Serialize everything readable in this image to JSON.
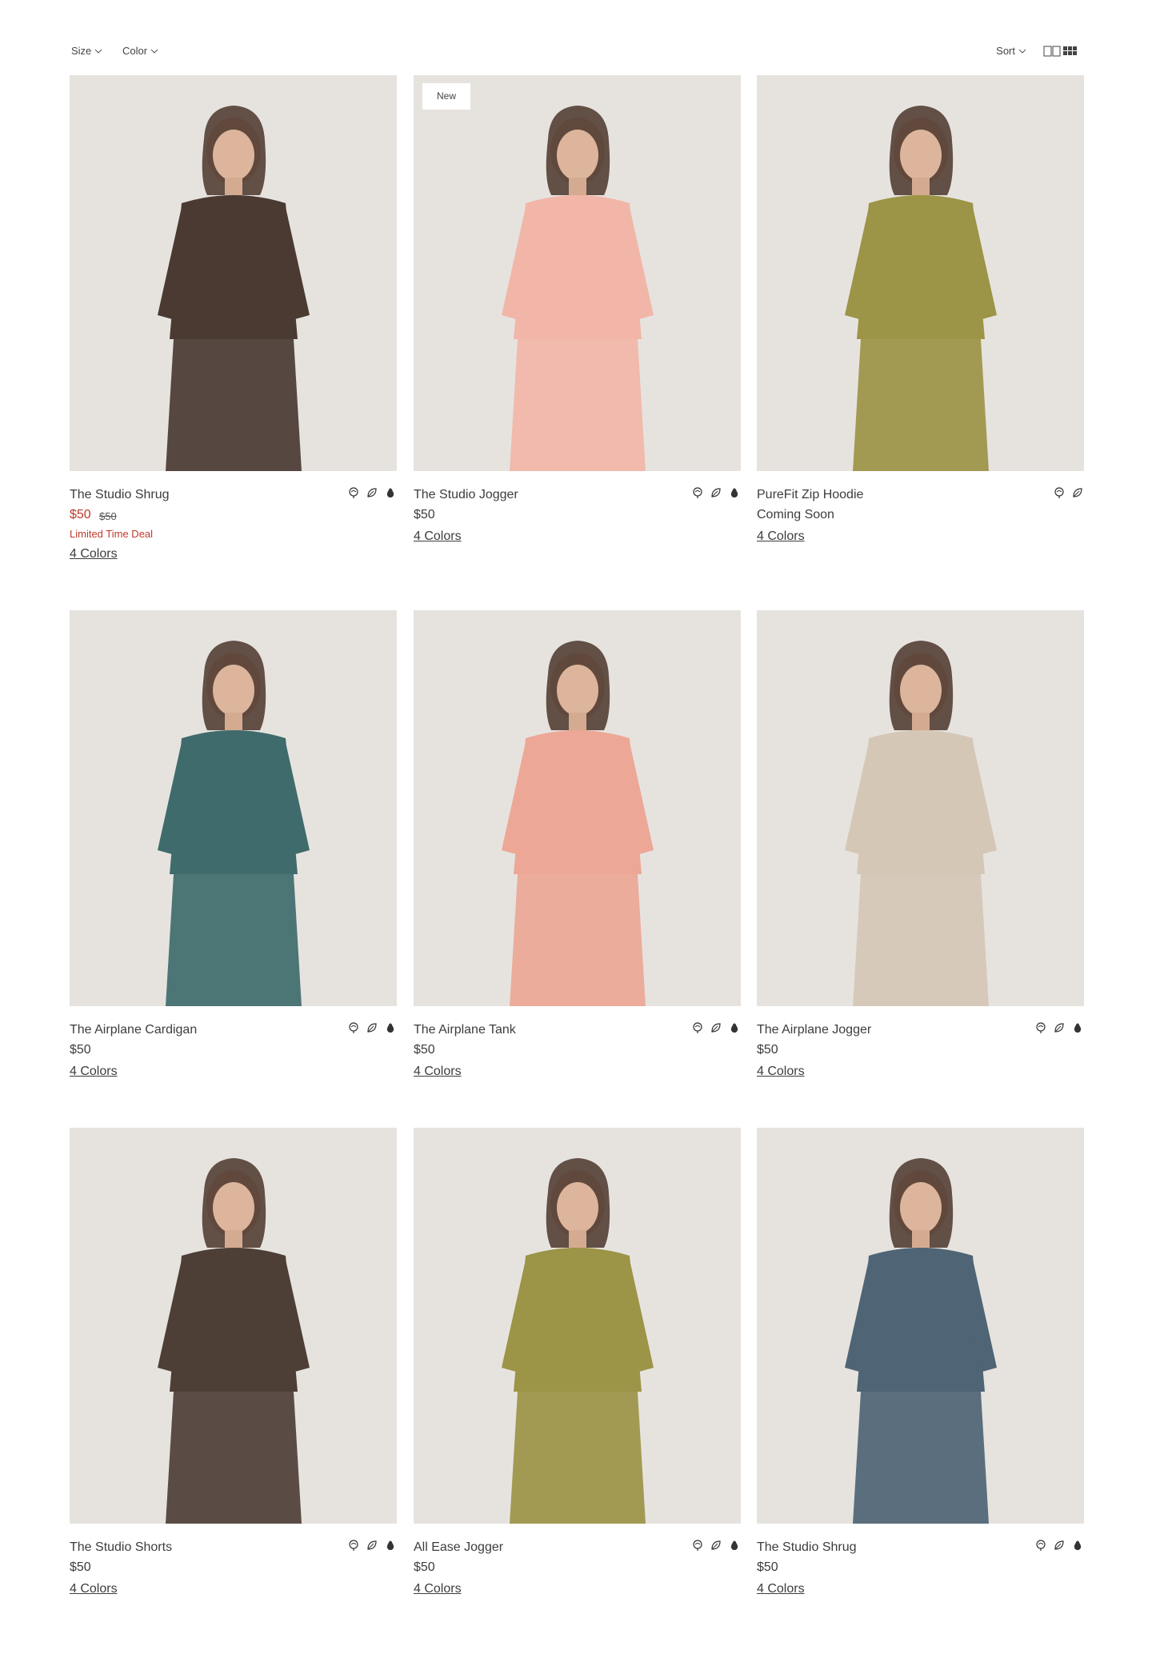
{
  "toolbar": {
    "size_label": "Size",
    "color_label": "Color",
    "sort_label": "Sort",
    "icons": [
      "chevron-down-icon",
      "two-column-grid-icon",
      "three-column-grid-icon"
    ]
  },
  "products": [
    {
      "name": "The Studio Shrug",
      "price": "$50",
      "original_price": "$50",
      "deal": "Limited Time Deal",
      "colors_label": "4 Colors",
      "badge": "",
      "garment": "#4a3a32",
      "sustainability_icons": 3
    },
    {
      "name": "The Studio Jogger",
      "price": "$50",
      "original_price": "",
      "deal": "",
      "colors_label": "4 Colors",
      "badge": "New",
      "garment": "#f2b6a8",
      "sustainability_icons": 3
    },
    {
      "name": "PureFit Zip Hoodie",
      "price": "Coming Soon",
      "original_price": "",
      "deal": "",
      "colors_label": "4 Colors",
      "badge": "",
      "garment": "#9c9446",
      "sustainability_icons": 2
    },
    {
      "name": "The Airplane Cardigan",
      "price": "$50",
      "original_price": "",
      "deal": "",
      "colors_label": "4 Colors",
      "badge": "",
      "garment": "#3f6b6c",
      "sustainability_icons": 3
    },
    {
      "name": "The Airplane Tank",
      "price": "$50",
      "original_price": "",
      "deal": "",
      "colors_label": "4 Colors",
      "badge": "",
      "garment": "#eda796",
      "sustainability_icons": 3
    },
    {
      "name": "The Airplane Jogger",
      "price": "$50",
      "original_price": "",
      "deal": "",
      "colors_label": "4 Colors",
      "badge": "",
      "garment": "#d5c7b6",
      "sustainability_icons": 3
    },
    {
      "name": "The Studio Shorts",
      "price": "$50",
      "original_price": "",
      "deal": "",
      "colors_label": "4 Colors",
      "badge": "",
      "garment": "#4e3f36",
      "sustainability_icons": 3
    },
    {
      "name": "All Ease Jogger",
      "price": "$50",
      "original_price": "",
      "deal": "",
      "colors_label": "4 Colors",
      "badge": "",
      "garment": "#9c9446",
      "sustainability_icons": 3
    },
    {
      "name": "The Studio Shrug",
      "price": "$50",
      "original_price": "",
      "deal": "",
      "colors_label": "4 Colors",
      "badge": "",
      "garment": "#4f6474",
      "sustainability_icons": 3
    }
  ],
  "colors": {
    "sale": "#c0392b",
    "text": "#3d3d3d",
    "photo_background": "#e6e3df"
  }
}
